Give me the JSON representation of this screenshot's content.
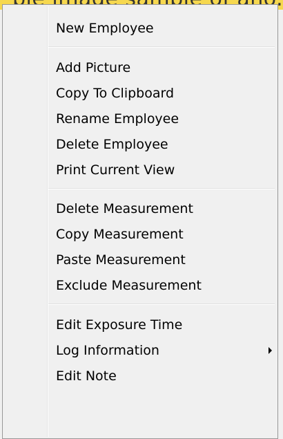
{
  "background": {
    "partial_text": "ple image sample of ano..."
  },
  "menu": {
    "groups": [
      {
        "items": [
          {
            "label": "New Employee"
          }
        ]
      },
      {
        "items": [
          {
            "label": "Add Picture"
          },
          {
            "label": "Copy To Clipboard"
          },
          {
            "label": "Rename Employee"
          },
          {
            "label": "Delete Employee"
          },
          {
            "label": "Print Current View"
          }
        ]
      },
      {
        "items": [
          {
            "label": "Delete Measurement"
          },
          {
            "label": "Copy Measurement"
          },
          {
            "label": "Paste Measurement"
          },
          {
            "label": "Exclude Measurement"
          }
        ]
      },
      {
        "items": [
          {
            "label": "Edit Exposure Time"
          },
          {
            "label": "Log Information",
            "submenu": true
          },
          {
            "label": "Edit Note"
          }
        ]
      }
    ]
  },
  "colors": {
    "menu_bg": "#f0f0f0",
    "menu_border": "#979797",
    "background_strip": "#f6d84f"
  }
}
